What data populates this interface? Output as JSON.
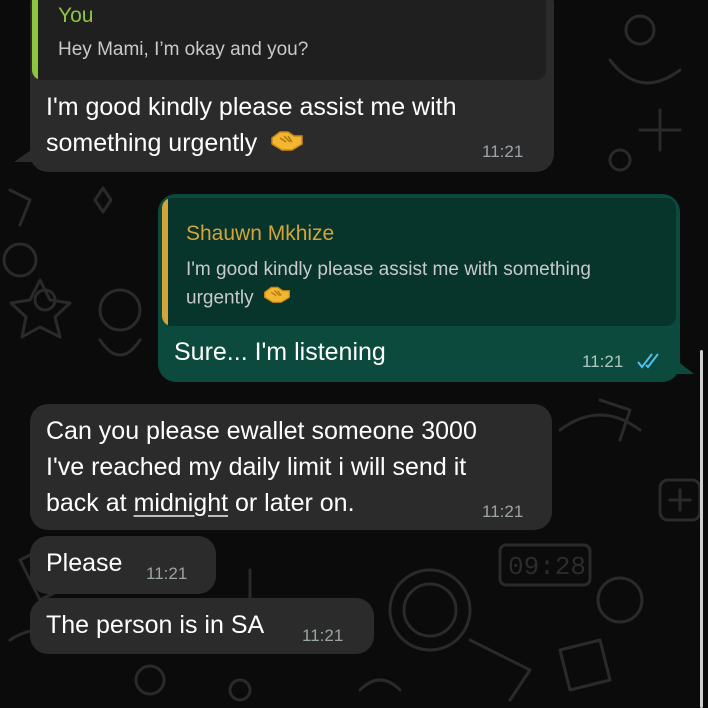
{
  "colors": {
    "background": "#0b0b0b",
    "incoming_bubble": "#2b2b2c",
    "outgoing_bubble": "#0b4a3d",
    "quote_you_accent": "#8cc63f",
    "quote_shauwn_accent": "#d4a43a",
    "read_ticks": "#53bdeb"
  },
  "messages": {
    "m1": {
      "quote": {
        "sender": "You",
        "text": "Hey Mami, I’m okay and you?"
      },
      "line1": "I'm good kindly please assist me with",
      "line2": "something urgently",
      "emoji_icon": "handshake-icon",
      "time": "11:21"
    },
    "m2": {
      "quote": {
        "sender": "Shauwn Mkhize",
        "line1": "I'm good kindly please assist me with something",
        "line2": "urgently",
        "emoji_icon": "handshake-icon"
      },
      "text": "Sure... I'm listening",
      "time": "11:21",
      "status_icon": "double-check-read-icon"
    },
    "m3": {
      "line1": "Can you please ewallet someone 3000",
      "line2": "I've reached my daily limit i will send it",
      "line3_a": "back at ",
      "line3_link": "midnight",
      "line3_b": " or later on.",
      "time": "11:21"
    },
    "m4": {
      "text": "Please",
      "time": "11:21"
    },
    "m5": {
      "text": "The person is in SA",
      "time": "11:21"
    }
  },
  "wallpaper": {
    "clock_text": "09:28"
  }
}
